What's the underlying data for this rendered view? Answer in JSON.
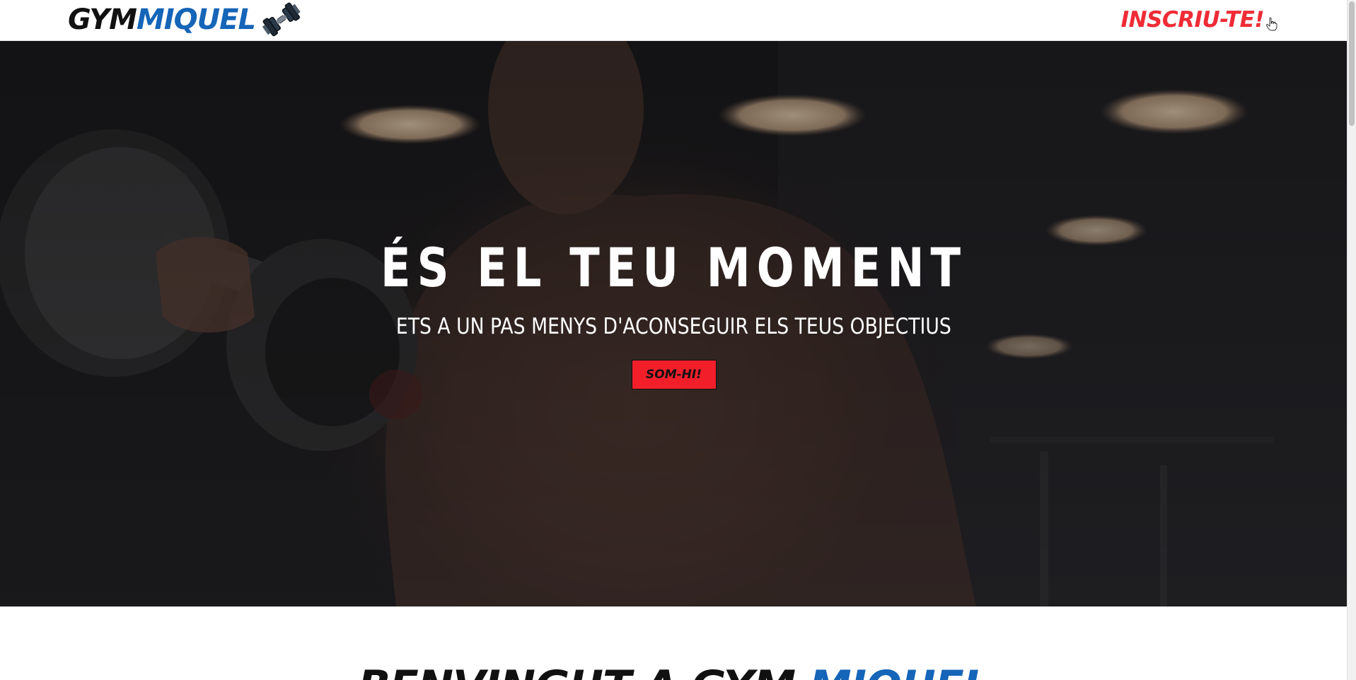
{
  "header": {
    "brand_part1": "GYM",
    "brand_part2": "MIQUEL",
    "brand_icon": "dumbbell-icon",
    "signup_label": "INSCRIU-TE!",
    "cursor_icon": "pointer-hand-icon"
  },
  "hero": {
    "title": "ÉS EL TEU MOMENT",
    "subtitle": "ETS A UN PAS MENYS D'ACONSEGUIR ELS TEUS OBJECTIUS",
    "cta_label": "SOM-HI!",
    "background_image": "man-lifting-dumbbell-photo"
  },
  "welcome": {
    "title_part1": "BENVINGUT A GYM ",
    "title_part2": "MIQUEL"
  },
  "colors": {
    "brand_blue": "#1565b8",
    "accent_red": "#ef2b36",
    "cta_red": "#f21f2b",
    "text_dark": "#111111"
  }
}
